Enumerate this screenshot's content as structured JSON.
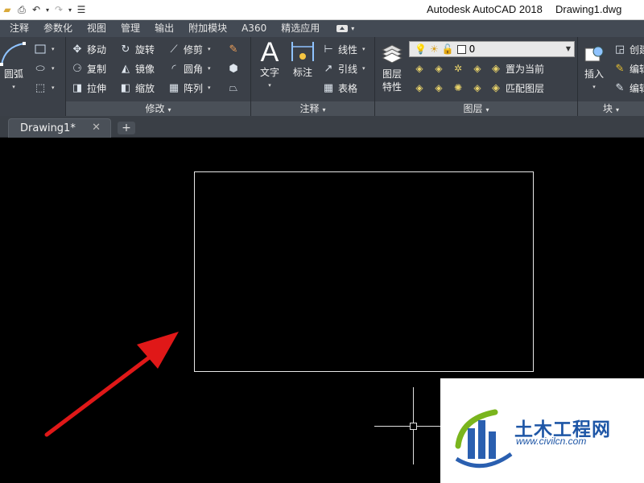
{
  "titlebar": {
    "app_name": "Autodesk AutoCAD 2018",
    "file_name": "Drawing1.dwg",
    "qat_icons": [
      "folder-icon",
      "save-icon",
      "print-icon",
      "undo-icon",
      "redo-icon",
      "customize-icon"
    ]
  },
  "ribbon_tabs": [
    "注释",
    "参数化",
    "视图",
    "管理",
    "输出",
    "附加模块",
    "A360",
    "精选应用"
  ],
  "panels": {
    "draw": {
      "arc_label": "圆弧"
    },
    "modify": {
      "label": "修改",
      "move": "移动",
      "rotate": "旋转",
      "trim": "修剪",
      "copy": "复制",
      "mirror": "镜像",
      "fillet": "圆角",
      "stretch": "拉伸",
      "scale": "缩放",
      "array": "阵列"
    },
    "annotation": {
      "label": "注释",
      "text": "文字",
      "dimension": "标注",
      "linear": "线性",
      "leader": "引线",
      "table": "表格"
    },
    "layers": {
      "label": "图层",
      "properties_line1": "图层",
      "properties_line2": "特性",
      "current_layer": "0",
      "set_current": "置为当前",
      "match_layer": "匹配图层"
    },
    "block": {
      "label": "块",
      "insert": "插入",
      "create": "创建",
      "edit": "编辑",
      "edit2": "编辑"
    }
  },
  "document_tabs": {
    "active": "Drawing1*",
    "new_tab_symbol": "+"
  },
  "watermark": {
    "name": "土木工程网",
    "url": "www.civilcn.com"
  },
  "colors": {
    "canvas": "#000000",
    "ribbon": "#3b4048",
    "arrow": "#e01818",
    "watermark_blue": "#1e56a6"
  }
}
